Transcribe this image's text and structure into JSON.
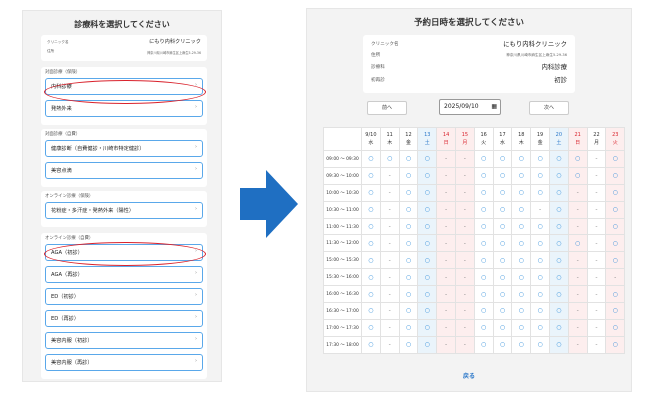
{
  "left": {
    "title": "診療科を選択してください",
    "clinic_label": "クリニック名",
    "clinic_name": "にもり内科クリニック",
    "address_label": "住所",
    "address": "神奈川県川崎市麻生区上麻生5-29-36",
    "groups": [
      {
        "label": "対面診療（保険）",
        "options": [
          "内科診療",
          "発熱外来"
        ]
      },
      {
        "label": "対面診療（自費）",
        "options": [
          "健康診断（自費健診・川崎市特定健診）",
          "美容点滴"
        ]
      },
      {
        "label": "オンライン診療（保険）",
        "options": [
          "花粉症・多汗症・発熱外来（陽性）"
        ]
      },
      {
        "label": "オンライン診療（自費）",
        "options": [
          "AGA（初診）",
          "AGA（再診）",
          "ED（初診）",
          "ED（再診）",
          "美容内服（初診）",
          "美容内服（再診）"
        ]
      }
    ],
    "chevron": "›"
  },
  "right": {
    "title": "予約日時を選択してください",
    "clinic_label": "クリニック名",
    "clinic_name": "にもり内科クリニック",
    "address_label": "住所",
    "address": "神奈川県川崎市麻生区上麻生5-29-36",
    "dept_label": "診療科",
    "dept_value": "内科診療",
    "visit_label": "初再診",
    "visit_value": "初診",
    "prev_label": "前へ",
    "next_label": "次へ",
    "date_value": "2025/09/10",
    "back_label": "戻る",
    "days": [
      {
        "d": "9/10",
        "w": "水",
        "k": "wd"
      },
      {
        "d": "11",
        "w": "木",
        "k": "wd"
      },
      {
        "d": "12",
        "w": "金",
        "k": "wd"
      },
      {
        "d": "13",
        "w": "土",
        "k": "sat"
      },
      {
        "d": "14",
        "w": "日",
        "k": "sun"
      },
      {
        "d": "15",
        "w": "月",
        "k": "sun"
      },
      {
        "d": "16",
        "w": "火",
        "k": "wd"
      },
      {
        "d": "17",
        "w": "水",
        "k": "wd"
      },
      {
        "d": "18",
        "w": "木",
        "k": "wd"
      },
      {
        "d": "19",
        "w": "金",
        "k": "wd"
      },
      {
        "d": "20",
        "w": "土",
        "k": "sat"
      },
      {
        "d": "21",
        "w": "日",
        "k": "sun"
      },
      {
        "d": "22",
        "w": "月",
        "k": "wd"
      },
      {
        "d": "23",
        "w": "火",
        "k": "sun"
      }
    ],
    "slots": [
      {
        "t": "09:00 ～ 09:30",
        "v": "OOOO--OOOOOO-O"
      },
      {
        "t": "09:30 ～ 10:00",
        "v": "O-OO--OOOOOO-O"
      },
      {
        "t": "10:00 ～ 10:30",
        "v": "O-OO--OOOOO--O"
      },
      {
        "t": "10:30 ～ 11:00",
        "v": "O-OO--OOO-O--O"
      },
      {
        "t": "11:00 ～ 11:30",
        "v": "O-OO--OOOOO--O"
      },
      {
        "t": "11:30 ～ 12:00",
        "v": "O-OO--OOOOOO-O"
      },
      {
        "t": "15:00 ～ 15:30",
        "v": "O-OO--OOOOO--O"
      },
      {
        "t": "15:30 ～ 16:00",
        "v": "O-OO--OOOOO---"
      },
      {
        "t": "16:00 ～ 16:30",
        "v": "O-OO--OOOOO--O"
      },
      {
        "t": "16:30 ～ 17:00",
        "v": "O-OO--OOOOO--O"
      },
      {
        "t": "17:00 ～ 17:30",
        "v": "O-OO--OOOOO--O"
      },
      {
        "t": "17:30 ～ 18:00",
        "v": "O-OO--OOOOO--O"
      }
    ],
    "available_mark": "○",
    "unavailable_mark": "-"
  },
  "colors": {
    "accent": "#2a77c9",
    "highlight_ring": "#d9232d",
    "arrow": "#1f6fc2"
  }
}
